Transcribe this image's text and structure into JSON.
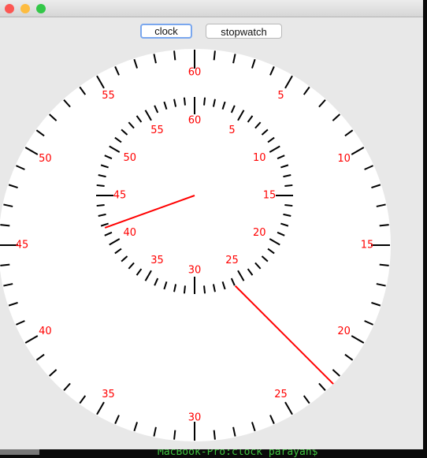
{
  "window": {
    "controls": [
      {
        "name": "close",
        "color": "#fc5753"
      },
      {
        "name": "minimize",
        "color": "#fdbc40"
      },
      {
        "name": "zoom",
        "color": "#33c748"
      }
    ]
  },
  "toolbar": {
    "clock_label": "clock",
    "stopwatch_label": "stopwatch",
    "selected": "clock"
  },
  "outer_dial": {
    "labels": [
      "60",
      "5",
      "10",
      "15",
      "20",
      "25",
      "30",
      "35",
      "40",
      "45",
      "50",
      "55"
    ],
    "hand_value": 22.5,
    "hand_color": "#ff0000"
  },
  "inner_dial": {
    "labels": [
      "60",
      "5",
      "10",
      "15",
      "20",
      "25",
      "30",
      "35",
      "40",
      "45",
      "50",
      "55"
    ],
    "hand_value": 41.7,
    "hand_color": "#ff0000"
  },
  "background_terminal": {
    "text": "MacBook-Pro:clock parayan$"
  }
}
